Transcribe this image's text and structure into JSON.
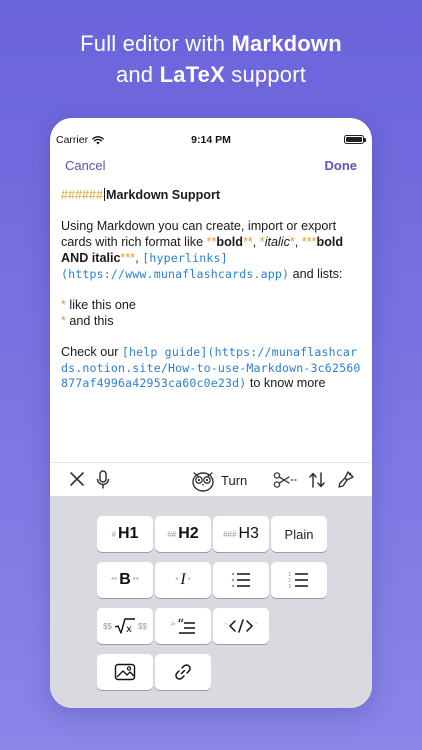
{
  "headline": {
    "line1_prefix": "Full editor with ",
    "line1_bold": "Markdown",
    "line2_prefix": "and ",
    "line2_bold": "LaTeX",
    "line2_suffix": " support"
  },
  "statusbar": {
    "carrier": "Carrier",
    "time": "9:14 PM"
  },
  "navbar": {
    "cancel": "Cancel",
    "done": "Done"
  },
  "editor": {
    "heading_marker": "######",
    "heading_text": "Markdown Support",
    "p1_a": "Using Markdown you can create, import or export cards with rich format like ",
    "bold_mark": "**",
    "bold_word": "bold",
    "comma1": ", ",
    "italic_mark": "*",
    "italic_word": "italic",
    "comma2": ", ",
    "bi_mark": "***",
    "bi_word": "bold AND italic",
    "comma3": ", ",
    "link_text": "[hyperlinks](https://www.munaflashcards.app)",
    "p1_end": " and lists:",
    "list_marker": "*",
    "list1": " like this one",
    "list2": " and this",
    "p3_a": "Check our ",
    "guide_link": "[help guide](https://munaflashcards.notion.site/How-to-use-Markdown-3c62560877af4996a42953ca60c0e23d)",
    "p3_b": " to know more"
  },
  "toolbar": {
    "turn_label": "Turn"
  },
  "keyboard": {
    "h1": {
      "pre": "#",
      "label": "H1"
    },
    "h2": {
      "pre": "##",
      "label": "H2"
    },
    "h3": {
      "pre": "###",
      "label": "H3"
    },
    "plain": "Plain",
    "bold": {
      "pre": "**",
      "label": "B",
      "post": "**"
    },
    "italic": {
      "pre": "*",
      "label": "I",
      "post": "*"
    },
    "latex": {
      "pre": "$$",
      "post": "$$"
    },
    "code": {
      "pre": "`",
      "post": "`"
    }
  },
  "colors": {
    "accent": "#5856b8",
    "markdown": "#e39a2d",
    "link": "#2d7fd6"
  }
}
